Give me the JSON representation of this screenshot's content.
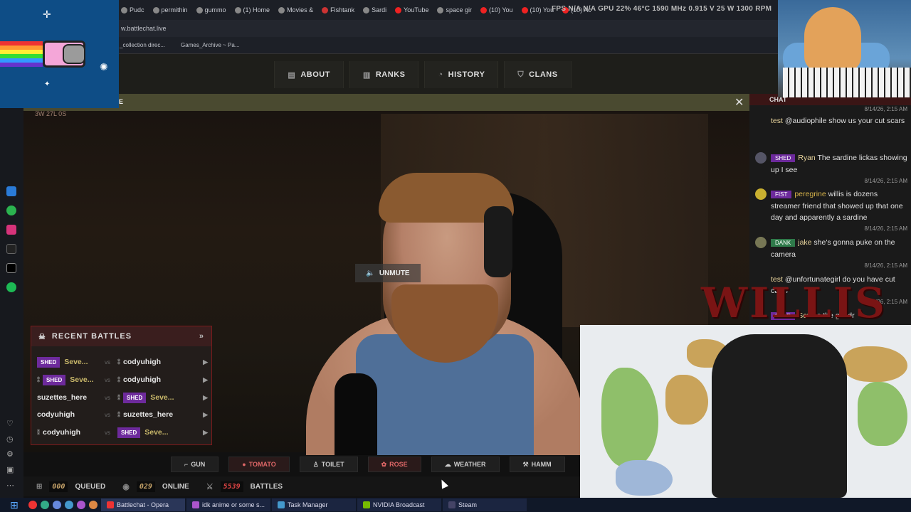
{
  "browser": {
    "tabs": [
      "Pudc",
      "permithin",
      "gummo",
      "(1) Home",
      "Movies &",
      "Fishtank",
      "Sardi",
      "YouTube",
      "space gir",
      "(10) You",
      "(10) You",
      "(10) Ac"
    ],
    "url": "w.battlechat.live",
    "bookmarks": [
      "_collection direc...",
      "Games_Archive ~ Pa..."
    ],
    "stats_overlay": "FPS N/A  N/A  GPU 22%  46°C  1590 MHz  0.915 V  25 W  1300 RPM"
  },
  "site_nav": {
    "items": [
      {
        "label": "ABOUT",
        "icon": "book-icon"
      },
      {
        "label": "RANKS",
        "icon": "bars-icon"
      },
      {
        "label": "HISTORY",
        "icon": "clock-icon"
      },
      {
        "label": "CLANS",
        "icon": "shield-icon"
      }
    ],
    "banner_letter": "E"
  },
  "video": {
    "record_tag": "3W 27L 0S",
    "unmute_label": "UNMUTE"
  },
  "recent_battles": {
    "title": "RECENT BATTLES",
    "vs": "vs",
    "rows": [
      {
        "p1": "Seve...",
        "p1_clan": "SHED",
        "p2": "codyuhigh",
        "p2_clan": ""
      },
      {
        "p1": "Seve...",
        "p1_clan": "SHED",
        "p2": "codyuhigh",
        "p2_clan": ""
      },
      {
        "p1": "suzettes_here",
        "p1_clan": "",
        "p2": "Seve...",
        "p2_clan": "SHED"
      },
      {
        "p1": "codyuhigh",
        "p1_clan": "",
        "p2": "suzettes_here",
        "p2_clan": ""
      },
      {
        "p1": "codyuhigh",
        "p1_clan": "",
        "p2": "Seve...",
        "p2_clan": "SHED"
      }
    ]
  },
  "actions": [
    {
      "label": "GUN",
      "highlight": false
    },
    {
      "label": "TOMATO",
      "highlight": true
    },
    {
      "label": "TOILET",
      "highlight": false
    },
    {
      "label": "ROSE",
      "highlight": true
    },
    {
      "label": "WEATHER",
      "highlight": false
    },
    {
      "label": "HAMM",
      "highlight": false
    }
  ],
  "status": {
    "queued_num": "000",
    "queued_label": "QUEUED",
    "online_num": "029",
    "online_label": "ONLINE",
    "battles_num": "5539",
    "battles_label": "BATTLES"
  },
  "chat": {
    "title": "CHAT",
    "top_time": "8/14/26, 2:15 AM",
    "messages": [
      {
        "clan": "",
        "clan_color": "",
        "user": "test",
        "text": "@audiophile show us your cut scars",
        "time": ""
      },
      {
        "clan": "SHED",
        "clan_color": "#6d2a9c",
        "user": "Ryan",
        "text": "The sardine lickas showing up I see",
        "time": "8/14/26, 2:15 AM"
      },
      {
        "clan": "FIST",
        "clan_color": "#6d2a9c",
        "user": "peregrine",
        "text": "willis is dozens streamer friend that showed up that one day and apparently a sardine",
        "time": "8/14/26, 2:15 AM"
      },
      {
        "clan": "DANK",
        "clan_color": "#2f7a4a",
        "user": "jake",
        "text": "she's gonna puke on the camera",
        "time": "8/14/26, 2:15 AM"
      },
      {
        "clan": "",
        "clan_color": "",
        "user": "test",
        "text": "@unfortunategirl do you have cut cars?",
        "time": "8/14/26, 2:15 AM"
      },
      {
        "clan": "SHED",
        "clan_color": "#6d2a9c",
        "user": "Seve",
        "text": "s the grindr",
        "time": ""
      }
    ],
    "logo": "WILLIS"
  },
  "taskbar": {
    "tasks": [
      "Battlechat - Opera",
      "idk anime or some s...",
      "Task Manager",
      "NVIDIA Broadcast",
      "Steam"
    ]
  }
}
